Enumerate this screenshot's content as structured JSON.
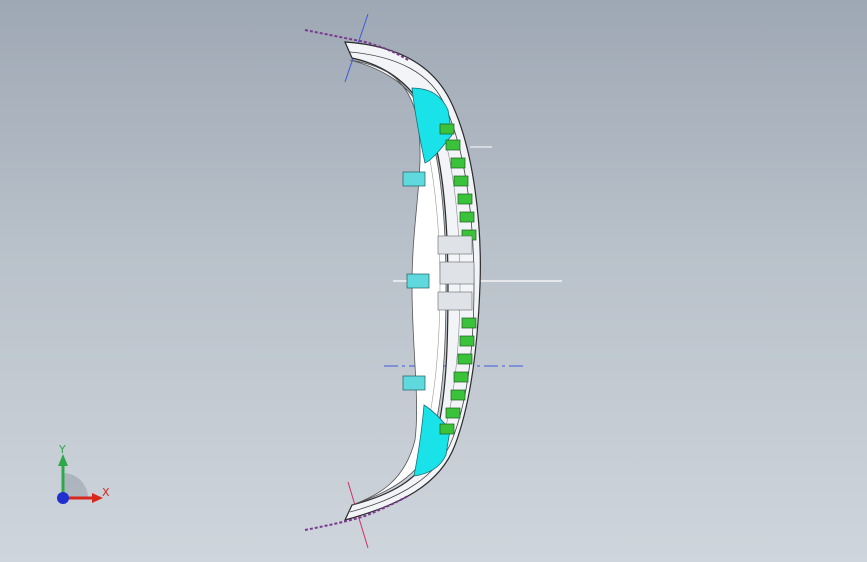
{
  "viewport": {
    "background_top": "#9ea8b4",
    "background_bottom": "#cfd5dc"
  },
  "model": {
    "part_outline_color": "#2b2b2b",
    "surface_color": "#f2f4f7",
    "highlight_cyan": "#19e3e8",
    "clip_green": "#39c23a",
    "wire_purple": "#7a3b8f",
    "blue_axis_color": "#3a5bd9",
    "red_axis_color": "#d0306a"
  },
  "triad": {
    "y_label": "Y",
    "x_label": "X",
    "y_color": "#2fa84a",
    "x_color": "#d8281e",
    "z_color": "#1f2fd0"
  }
}
